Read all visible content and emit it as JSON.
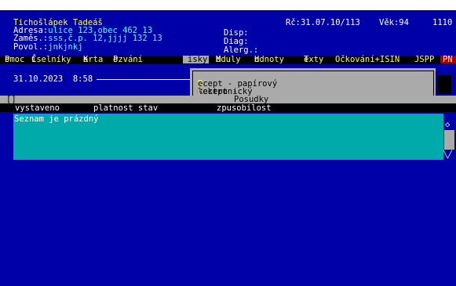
{
  "header": {
    "patient_name": "Tichošlápek Tadeáš",
    "rc": "Rč:31.07.10/113",
    "age": "Věk:94",
    "code": "1110",
    "address": "Adresa:ulice 123,obec 462 13",
    "disp": "Disp:",
    "employer": "Zaměs.:sss,č.p. 12,jjjj 132 13",
    "diag": "Diag:",
    "occupation": "Povol.:jnkjnkj",
    "alerg": "Alerg.:"
  },
  "menu": [
    {
      "first": "P",
      "rest": "omoc"
    },
    {
      "first": "Č",
      "rest": "íselníky"
    },
    {
      "first": "K",
      "rest": "arta"
    },
    {
      "first": "P",
      "rest": "ozvání"
    },
    {
      "label": "isky"
    },
    {
      "first": "M",
      "rest": "oduly"
    },
    {
      "first": "H",
      "rest": "odnoty"
    },
    {
      "first": "T",
      "rest": "exty"
    },
    {
      "label": "Očkování+ISIN"
    },
    {
      "label": "JSPP"
    },
    {
      "label": "PN"
    }
  ],
  "datetime": "31.10.2023  8:58",
  "dropdown": {
    "items": [
      {
        "hotkey": "R",
        "rest": "ecept - papírový"
      },
      {
        "lead": "Recept - ",
        "hotkey": "E",
        "rest": "lektronický"
      },
      {
        "label": "Posudky"
      }
    ]
  },
  "strip_label": "[]",
  "columns": [
    "vystaveno",
    "platnost stav",
    "zpusobilost"
  ],
  "list": {
    "empty_text": "Seznam je prázdný"
  },
  "scrollbar": {
    "up": "◇",
    "down": "╲╱"
  }
}
